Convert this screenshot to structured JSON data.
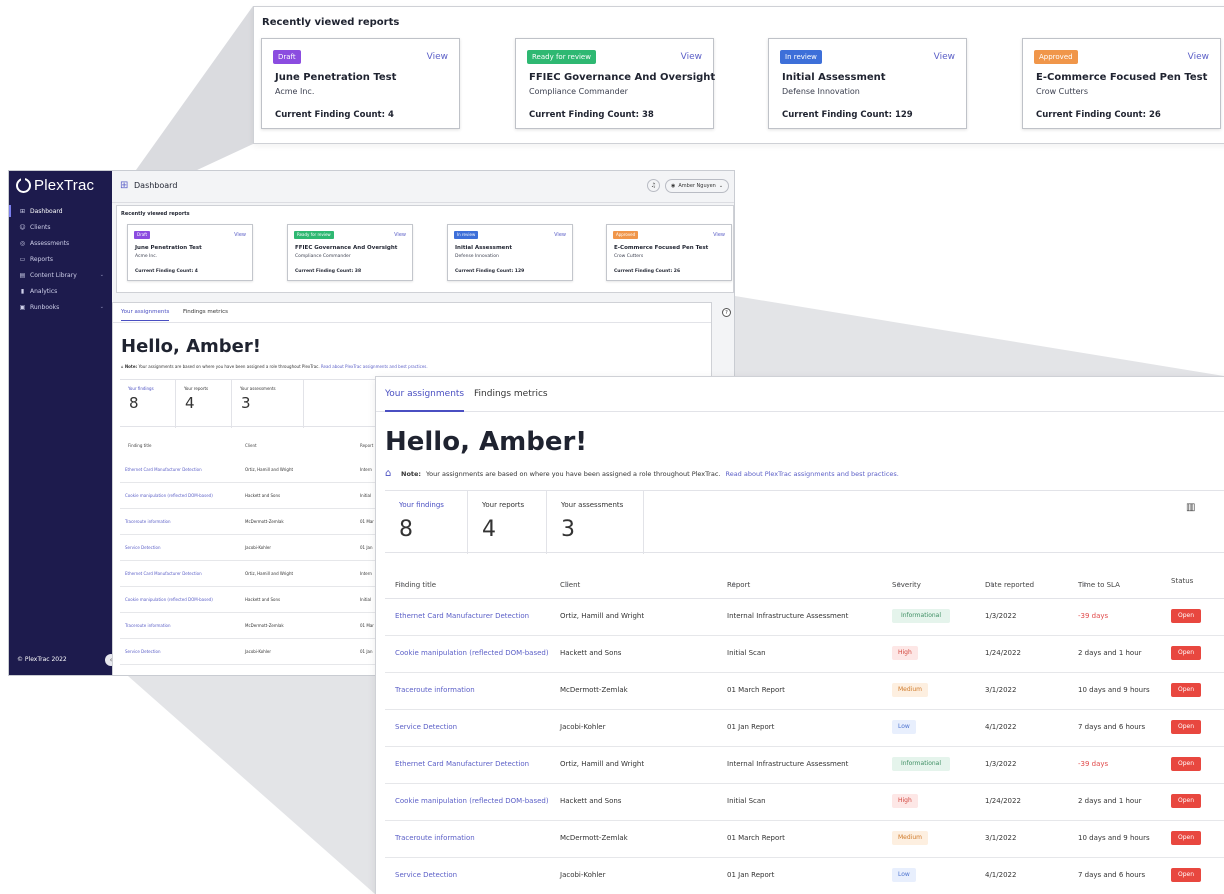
{
  "recent": {
    "title": "Recently viewed reports",
    "view_label": "View",
    "cards": [
      {
        "badge": "Draft",
        "badge_color": "#8b4ce0",
        "title": "June Penetration Test",
        "client": "Acme Inc.",
        "count": "Current Finding Count: 4"
      },
      {
        "badge": "Ready for review",
        "badge_color": "#2eb872",
        "title": "FFIEC Governance And Oversight",
        "client": "Compliance Commander",
        "count": "Current Finding Count: 38"
      },
      {
        "badge": "In review",
        "badge_color": "#3d6fd9",
        "title": "Initial Assessment",
        "client": "Defense Innovation",
        "count": "Current Finding Count: 129"
      },
      {
        "badge": "Approved",
        "badge_color": "#f0964a",
        "title": "E-Commerce Focused Pen Test",
        "client": "Crow Cutters",
        "count": "Current Finding Count: 26"
      }
    ]
  },
  "app": {
    "logo": "PlexTrac",
    "page_title": "Dashboard",
    "user": "Amber Nguyen",
    "copyright": "© PlexTrac 2022",
    "nav": [
      {
        "label": "Dashboard",
        "icon": "dashboard-icon",
        "active": true
      },
      {
        "label": "Clients",
        "icon": "clients-icon"
      },
      {
        "label": "Assessments",
        "icon": "assessments-icon"
      },
      {
        "label": "Reports",
        "icon": "reports-icon"
      },
      {
        "label": "Content Library",
        "icon": "content-library-icon",
        "chevron": true
      },
      {
        "label": "Analytics",
        "icon": "analytics-icon"
      },
      {
        "label": "Runbooks",
        "icon": "runbooks-icon",
        "chevron": true
      }
    ]
  },
  "assignments": {
    "tabs": [
      "Your assignments",
      "Findings metrics"
    ],
    "greeting": "Hello, Amber!",
    "note_bold": "Note:",
    "note_text": "Your assignments are based on where you have been assigned a role throughout PlexTrac.",
    "note_link": "Read about PlexTrac assignments and best practices.",
    "stats": [
      {
        "label": "Your findings",
        "value": "8"
      },
      {
        "label": "Your reports",
        "value": "4"
      },
      {
        "label": "Your assessments",
        "value": "3"
      }
    ],
    "columns": [
      "Finding title",
      "Client",
      "Report",
      "Severity",
      "Date reported",
      "Time to SLA",
      "Status"
    ],
    "rows": [
      {
        "title": "Ethernet Card Manufacturer Detection",
        "client": "Ortiz, Hamill and Wright",
        "report": "Internal Infrastructure Assessment",
        "severity": "Informational",
        "date": "1/3/2022",
        "sla": "-39 days",
        "status": "Open"
      },
      {
        "title": "Cookie manipulation (reflected DOM-based)",
        "client": "Hackett and Sons",
        "report": "Initial Scan",
        "severity": "High",
        "date": "1/24/2022",
        "sla": "2 days and 1 hour",
        "status": "Open"
      },
      {
        "title": "Traceroute information",
        "client": "McDermott-Zemlak",
        "report": "01 March Report",
        "severity": "Medium",
        "date": "3/1/2022",
        "sla": "10 days and 9 hours",
        "status": "Open"
      },
      {
        "title": "Service Detection",
        "client": "Jacobi-Kohler",
        "report": "01 Jan Report",
        "severity": "Low",
        "date": "4/1/2022",
        "sla": "7 days and 6 hours",
        "status": "Open"
      },
      {
        "title": "Ethernet Card Manufacturer Detection",
        "client": "Ortiz, Hamill and Wright",
        "report": "Internal Infrastructure Assessment",
        "severity": "Informational",
        "date": "1/3/2022",
        "sla": "-39 days",
        "status": "Open"
      },
      {
        "title": "Cookie manipulation (reflected DOM-based)",
        "client": "Hackett and Sons",
        "report": "Initial Scan",
        "severity": "High",
        "date": "1/24/2022",
        "sla": "2 days and 1 hour",
        "status": "Open"
      },
      {
        "title": "Traceroute information",
        "client": "McDermott-Zemlak",
        "report": "01 March Report",
        "severity": "Medium",
        "date": "3/1/2022",
        "sla": "10 days and 9 hours",
        "status": "Open"
      },
      {
        "title": "Service Detection",
        "client": "Jacobi-Kohler",
        "report": "01 Jan Report",
        "severity": "Low",
        "date": "4/1/2022",
        "sla": "7 days and 6 hours",
        "status": "Open"
      }
    ],
    "mini_rows": [
      {
        "title": "Ethernet Card Manufacturer Detection",
        "client": "Ortiz, Hamill and Wright",
        "report": "Intern"
      },
      {
        "title": "Cookie manipulation (reflected DOM-based)",
        "client": "Hackett and Sons",
        "report": "Initial"
      },
      {
        "title": "Traceroute information",
        "client": "McDermott-Zemlak",
        "report": "01 Mar"
      },
      {
        "title": "Service Detection",
        "client": "Jacobi-Kohler",
        "report": "01 Jan"
      },
      {
        "title": "Ethernet Card Manufacturer Detection",
        "client": "Ortiz, Hamill and Wright",
        "report": "Intern"
      },
      {
        "title": "Cookie manipulation (reflected DOM-based)",
        "client": "Hackett and Sons",
        "report": "Initial"
      },
      {
        "title": "Traceroute information",
        "client": "McDermott-Zemlak",
        "report": "01 Mar"
      },
      {
        "title": "Service Detection",
        "client": "Jacobi-Kohler",
        "report": "01 Jan"
      }
    ]
  }
}
